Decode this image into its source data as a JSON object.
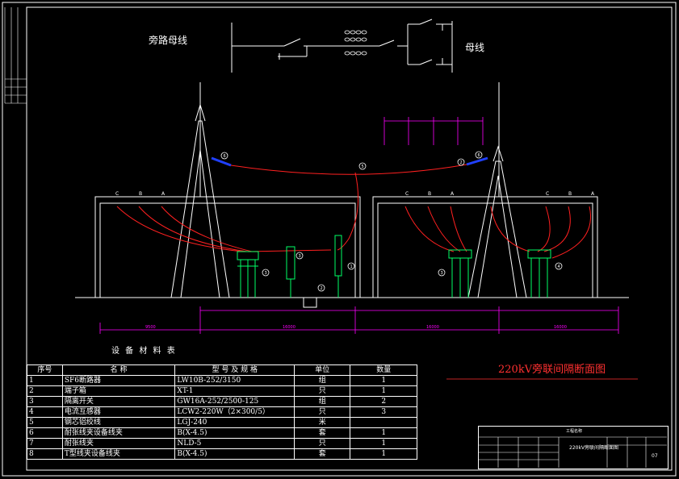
{
  "diagram": {
    "bypass_bus_label": "旁路母线",
    "main_bus_label": "母线",
    "drawing_title": "220kV旁联间隔断面图",
    "table_title": "设 备 材 料 表",
    "phases": [
      "C",
      "B",
      "A"
    ],
    "callouts": [
      "6",
      "5",
      "1",
      "2",
      "4",
      "3",
      "7",
      "8"
    ],
    "dims_bottom": [
      "9500",
      "16000",
      "16000",
      "16000"
    ],
    "colors": {
      "background": "#000000",
      "frame": "#ffffff",
      "conductor": "#ff2020",
      "equipment": "#00ff66",
      "dimension": "#ff00ff",
      "insulator": "#2040ff"
    }
  },
  "material_table": {
    "headers": [
      "序号",
      "名 称",
      "型 号 及 规 格",
      "单位",
      "数量"
    ],
    "rows": [
      [
        "1",
        "SF6断路器",
        "LW10B-252/3150",
        "组",
        "1"
      ],
      [
        "2",
        "端子箱",
        "XT-1",
        "只",
        "1"
      ],
      [
        "3",
        "隔离开关",
        "GW16A-252/2500-125",
        "组",
        "2"
      ],
      [
        "4",
        "电流互感器",
        "LCW2-220W（2×300/5）",
        "只",
        "3"
      ],
      [
        "5",
        "钢芯铝绞线",
        "LGJ-240",
        "米",
        ""
      ],
      [
        "6",
        "耐张线夹设备线夹",
        "B(X-4.5)",
        "套",
        "1"
      ],
      [
        "7",
        "耐张线夹",
        "NLD-5",
        "只",
        "1"
      ],
      [
        "8",
        "T型线夹设备线夹",
        "B(X-4.5)",
        "套",
        "1"
      ]
    ]
  },
  "title_block": {
    "project": "工程名称",
    "drawing_name": "220kV旁联间隔断面图",
    "sheet": "07"
  }
}
